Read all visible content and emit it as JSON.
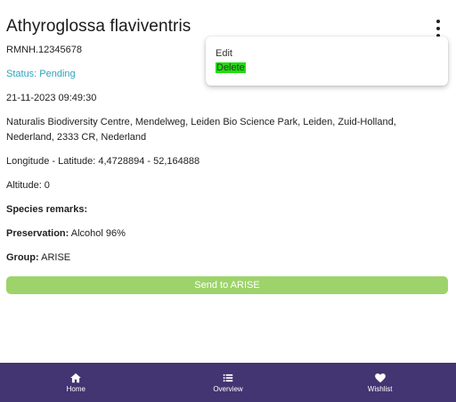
{
  "header": {
    "title": "Athyroglossa flaviventris",
    "menu_icon": "more-vertical-icon"
  },
  "details": {
    "registration_number": "RMNH.12345678",
    "status": "Status: Pending",
    "datetime": "21-11-2023 09:49:30",
    "address_line1": "Naturalis Biodiversity Centre, Mendelweg, Leiden Bio Science Park, Leiden, Zuid-Holland,",
    "address_line2": "Nederland, 2333 CR, Nederland",
    "coordinates": "Longitude - Latitude: 4,4728894 - 52,164888",
    "altitude": "Altitude: 0",
    "species_remarks_label": "Species remarks:",
    "preservation_label": "Preservation:",
    "preservation_value": "Alcohol 96%",
    "group_label": "Group:",
    "group_value": "ARISE"
  },
  "actions": {
    "send_label": "Send to ARISE"
  },
  "menu": {
    "edit_label": "Edit",
    "delete_label": "Delete"
  },
  "bottom_nav": {
    "items": [
      {
        "label": "Home",
        "icon": "home-icon"
      },
      {
        "label": "Overview",
        "icon": "list-icon"
      },
      {
        "label": "Wishlist",
        "icon": "heart-icon"
      }
    ]
  },
  "colors": {
    "status": "#2fa3bb",
    "send_button": "#9dd36a",
    "nav_background": "#433472",
    "delete_highlight": "#22dd11"
  }
}
